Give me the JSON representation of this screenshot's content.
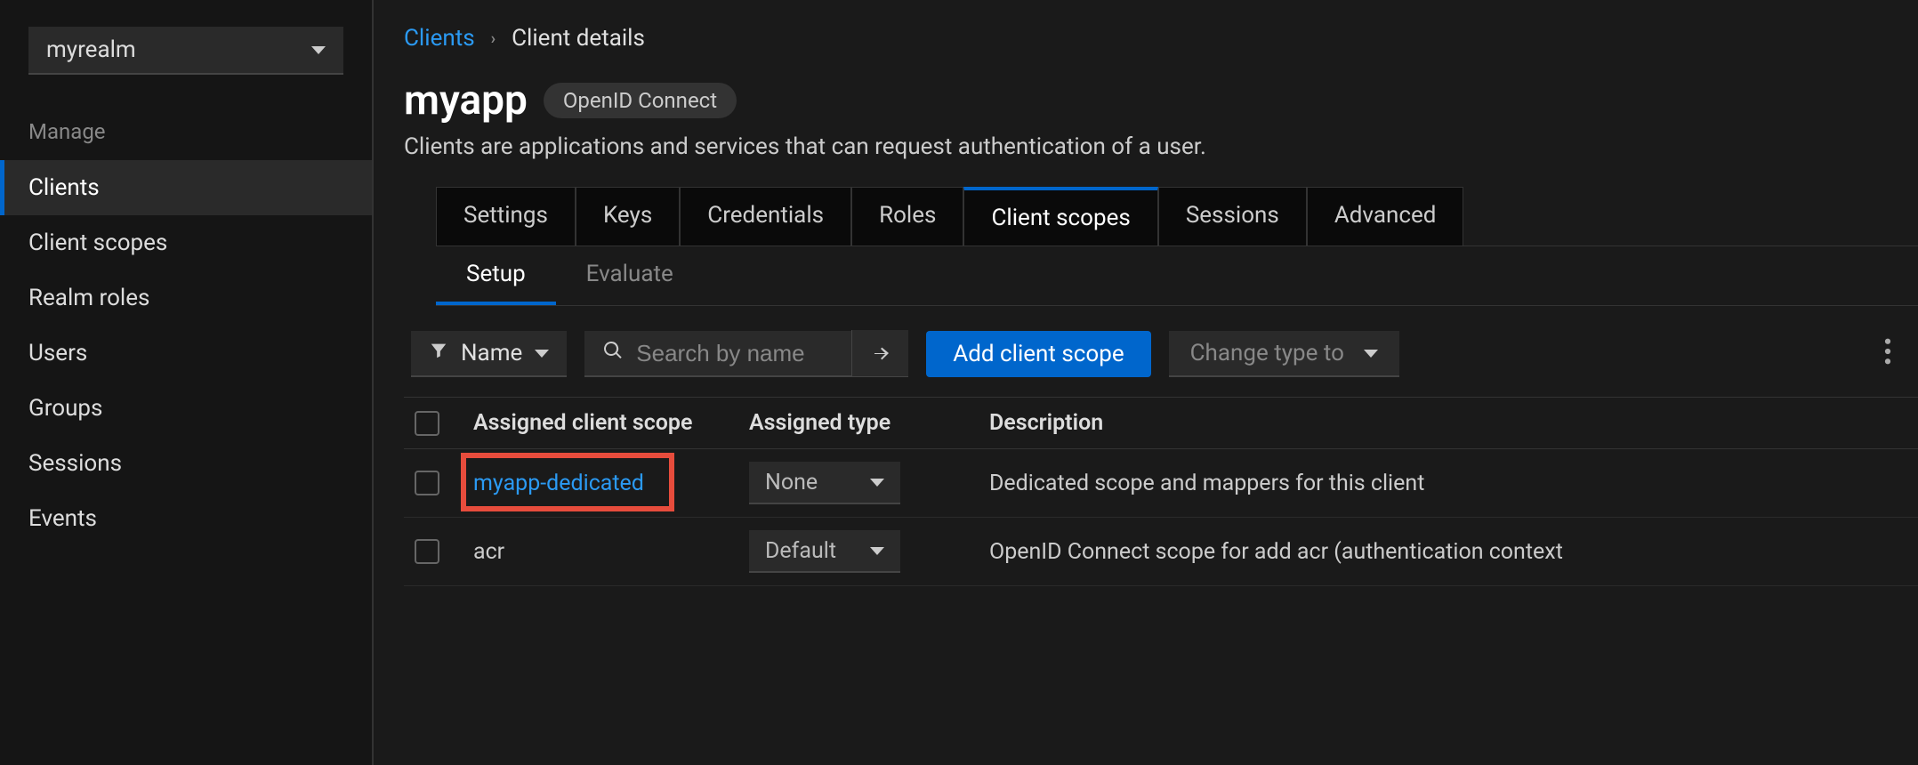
{
  "realm": {
    "selected": "myrealm"
  },
  "sidebar": {
    "section": "Manage",
    "items": [
      "Clients",
      "Client scopes",
      "Realm roles",
      "Users",
      "Groups",
      "Sessions",
      "Events"
    ],
    "active": 0
  },
  "breadcrumb": {
    "root": "Clients",
    "current": "Client details"
  },
  "header": {
    "title": "myapp",
    "pill": "OpenID Connect",
    "subtitle": "Clients are applications and services that can request authentication of a user."
  },
  "tabs1": [
    "Settings",
    "Keys",
    "Credentials",
    "Roles",
    "Client scopes",
    "Sessions",
    "Advanced"
  ],
  "tabs1_active": 4,
  "tabs2": [
    "Setup",
    "Evaluate"
  ],
  "tabs2_active": 0,
  "toolbar": {
    "filter_label": "Name",
    "search_placeholder": "Search by name",
    "add_button": "Add client scope",
    "change_type": "Change type to"
  },
  "table": {
    "columns": [
      "Assigned client scope",
      "Assigned type",
      "Description"
    ],
    "rows": [
      {
        "scope": "myapp-dedicated",
        "type": "None",
        "description": "Dedicated scope and mappers for this client"
      },
      {
        "scope": "acr",
        "type": "Default",
        "description": "OpenID Connect scope for add acr (authentication context "
      }
    ]
  }
}
